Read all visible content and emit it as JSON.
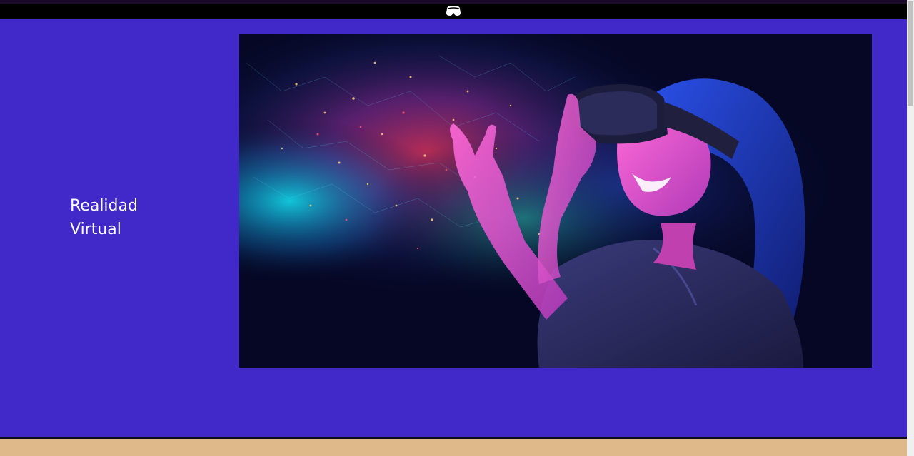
{
  "header": {
    "logo_icon": "vr-headset-icon"
  },
  "main": {
    "title_line1": "Realidad",
    "title_line2": "Virtual",
    "hero_image": "vr-woman-headset-particles-image"
  },
  "colors": {
    "main_bg": "#4128c9",
    "topbar_bg": "#000000",
    "footer_bg": "#e0b98a",
    "title_text": "#ffffff"
  }
}
